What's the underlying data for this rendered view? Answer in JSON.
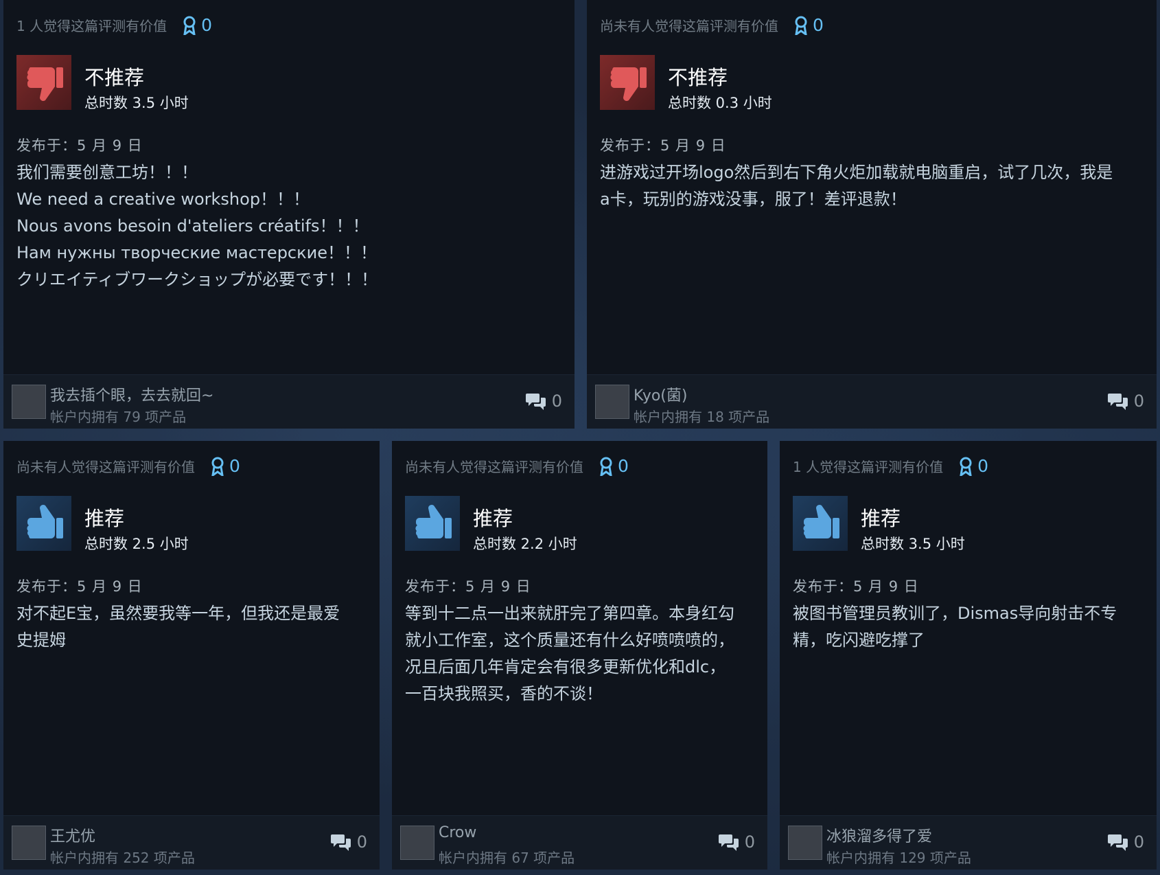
{
  "reviews": [
    {
      "helpful_text": "1 人觉得这篇评测有价值",
      "award_count": "0",
      "vote": "不推荐",
      "vote_type": "down",
      "hours": "总时数 3.5 小时",
      "posted": "发布于：5 月 9 日",
      "lines": [
        "我们需要创意工坊！！！",
        "We need a creative workshop！！！",
        "Nous avons besoin d'ateliers créatifs！！！",
        "Нам нужны творческие мастерские！！！",
        "クリエイティブワークショップが必要です！！！"
      ],
      "author": "我去插个眼，去去就回~",
      "owned": "帐户内拥有 79 项产品",
      "comment_count": "0"
    },
    {
      "helpful_text": "尚未有人觉得这篇评测有价值",
      "award_count": "0",
      "vote": "不推荐",
      "vote_type": "down",
      "hours": "总时数 0.3 小时",
      "posted": "发布于：5 月 9 日",
      "lines": [
        "进游戏过开场logo然后到右下角火炬加载就电脑重启，试了几次，我是",
        "a卡，玩别的游戏没事，服了！差评退款！"
      ],
      "author": "Kyo(菌)",
      "owned": "帐户内拥有 18 项产品",
      "comment_count": "0"
    },
    {
      "helpful_text": "尚未有人觉得这篇评测有价值",
      "award_count": "0",
      "vote": "推荐",
      "vote_type": "up",
      "hours": "总时数 2.5 小时",
      "posted": "发布于：5 月 9 日",
      "lines": [
        "对不起E宝，虽然要我等一年，但我还是最爱",
        "史提姆"
      ],
      "author": "王尤优",
      "owned": "帐户内拥有 252 项产品",
      "comment_count": "0"
    },
    {
      "helpful_text": "尚未有人觉得这篇评测有价值",
      "award_count": "0",
      "vote": "推荐",
      "vote_type": "up",
      "hours": "总时数 2.2 小时",
      "posted": "发布于：5 月 9 日",
      "lines": [
        "等到十二点一出来就肝完了第四章。本身红勾",
        "就小工作室，这个质量还有什么好喷喷喷的，",
        "况且后面几年肯定会有很多更新优化和dlc，",
        "一百块我照买，香的不谈！"
      ],
      "author": "Crow",
      "owned": "帐户内拥有 67 项产品",
      "comment_count": "0"
    },
    {
      "helpful_text": "1 人觉得这篇评测有价值",
      "award_count": "0",
      "vote": "推荐",
      "vote_type": "up",
      "hours": "总时数 3.5 小时",
      "posted": "发布于：5 月 9 日",
      "lines": [
        "被图书管理员教训了，Dismas导向射击不专",
        "精，吃闪避吃撑了"
      ],
      "author": "冰狼溜多得了爱",
      "owned": "帐户内拥有 129 项产品",
      "comment_count": "0"
    }
  ],
  "icons": {
    "award": "award-ribbon-icon",
    "thumbs_down": "thumbs-down-icon",
    "thumbs_up": "thumbs-up-icon",
    "comments": "speech-bubbles-icon"
  },
  "colors": {
    "accent": "#66c0f4",
    "card": "#0f141c",
    "negative": "#c94343",
    "positive": "#5ba6e0"
  }
}
